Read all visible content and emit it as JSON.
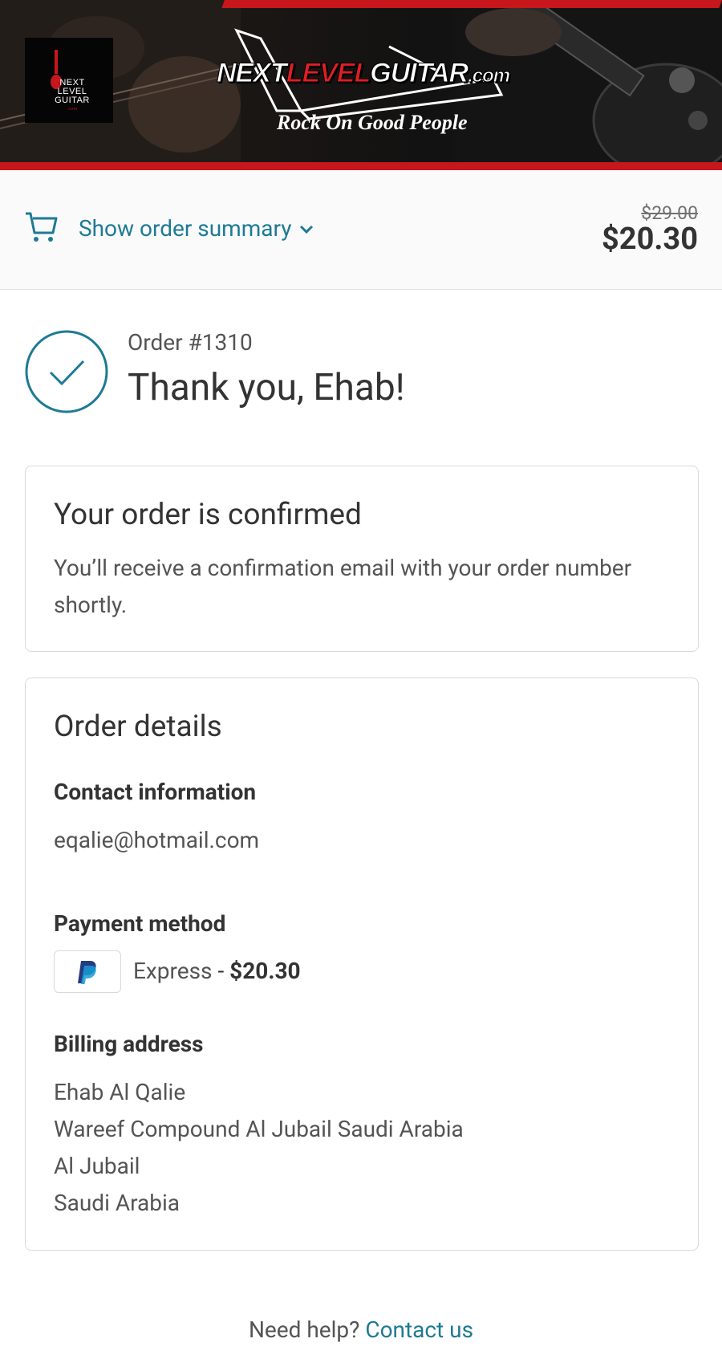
{
  "header": {
    "logo_lines": [
      "NEXT",
      "LEVEL",
      "GUITAR",
      ".com"
    ],
    "brand_part1": "NEXT",
    "brand_part2": "LEVEL",
    "brand_part3": "GUITAR",
    "brand_part4": ".com",
    "tagline": "Rock On Good People",
    "colors": {
      "accent_red": "#c8161d"
    }
  },
  "summary": {
    "toggle_label": "Show order summary",
    "original_price": "$29.00",
    "total_price": "$20.30",
    "icons": [
      "cart-icon",
      "chevron-down-icon"
    ]
  },
  "order": {
    "number": "Order #1310",
    "thank_you": "Thank you, Ehab!"
  },
  "confirmation": {
    "title": "Your order is confirmed",
    "text": "You’ll receive a confirmation email with your order number shortly."
  },
  "details": {
    "title": "Order details",
    "contact_heading": "Contact information",
    "contact_email": "eqalie@hotmail.com",
    "payment_heading": "Payment method",
    "payment_method": "Express",
    "payment_separator": " - ",
    "payment_amount": "$20.30",
    "billing_heading": "Billing address",
    "billing_lines": [
      "Ehab Al Qalie",
      "Wareef Compound Al Jubail Saudi Arabia",
      "Al Jubail",
      "Saudi Arabia"
    ]
  },
  "footer": {
    "help_text": "Need help?",
    "contact_link": "Contact us"
  },
  "theme": {
    "link_color": "#1e7a94",
    "text_color": "#333333"
  }
}
